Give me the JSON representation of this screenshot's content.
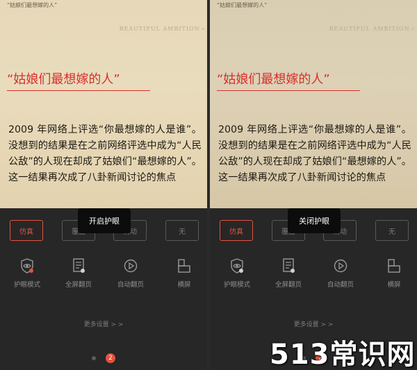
{
  "screens": [
    {
      "running_head": "“姑娘们最想嫁的人”",
      "brand_mark": "BEAUTIFUL AMBITION",
      "chapter_title": "“姑娘们最想嫁的人”",
      "body_text": "2009 年网络上评选“你最想嫁的人是谁”。没想到的结果是在之前网络评选中成为“人民公敌”的人现在却成了姑娘们“最想嫁的人”。这一结果再次成了八卦新闻讨论的焦点",
      "toast": "开启护眼",
      "modes": [
        "仿真",
        "覆盖",
        "滑动",
        "无"
      ],
      "tools": [
        {
          "label": "护眼模式",
          "icon": "eye-shield-icon"
        },
        {
          "label": "全屏翻页",
          "icon": "fullscreen-page-icon"
        },
        {
          "label": "自动翻页",
          "icon": "auto-play-icon"
        },
        {
          "label": "横屏",
          "icon": "landscape-icon"
        }
      ],
      "more_settings": "更多设置 > >",
      "page_number": "2"
    },
    {
      "running_head": "“姑娘们最想嫁的人”",
      "brand_mark": "BEAUTIFUL AMBITION",
      "chapter_title": "“姑娘们最想嫁的人”",
      "body_text": "2009 年网络上评选“你最想嫁的人是谁”。没想到的结果是在之前网络评选中成为“人民公敌”的人现在却成了姑娘们“最想嫁的人”。这一结果再次成了八卦新闻讨论的焦点",
      "toast": "关闭护眼",
      "modes": [
        "仿真",
        "覆盖",
        "滑动",
        "无"
      ],
      "tools": [
        {
          "label": "护眼模式",
          "icon": "eye-shield-icon"
        },
        {
          "label": "全屏翻页",
          "icon": "fullscreen-page-icon"
        },
        {
          "label": "自动翻页",
          "icon": "auto-play-icon"
        },
        {
          "label": "横屏",
          "icon": "landscape-icon"
        }
      ],
      "more_settings": "更多设置 > >",
      "page_number": "2"
    }
  ],
  "watermark": "513常识网",
  "colors": {
    "accent": "#e2533f",
    "title_red": "#d7302b",
    "panel": "#282828"
  }
}
